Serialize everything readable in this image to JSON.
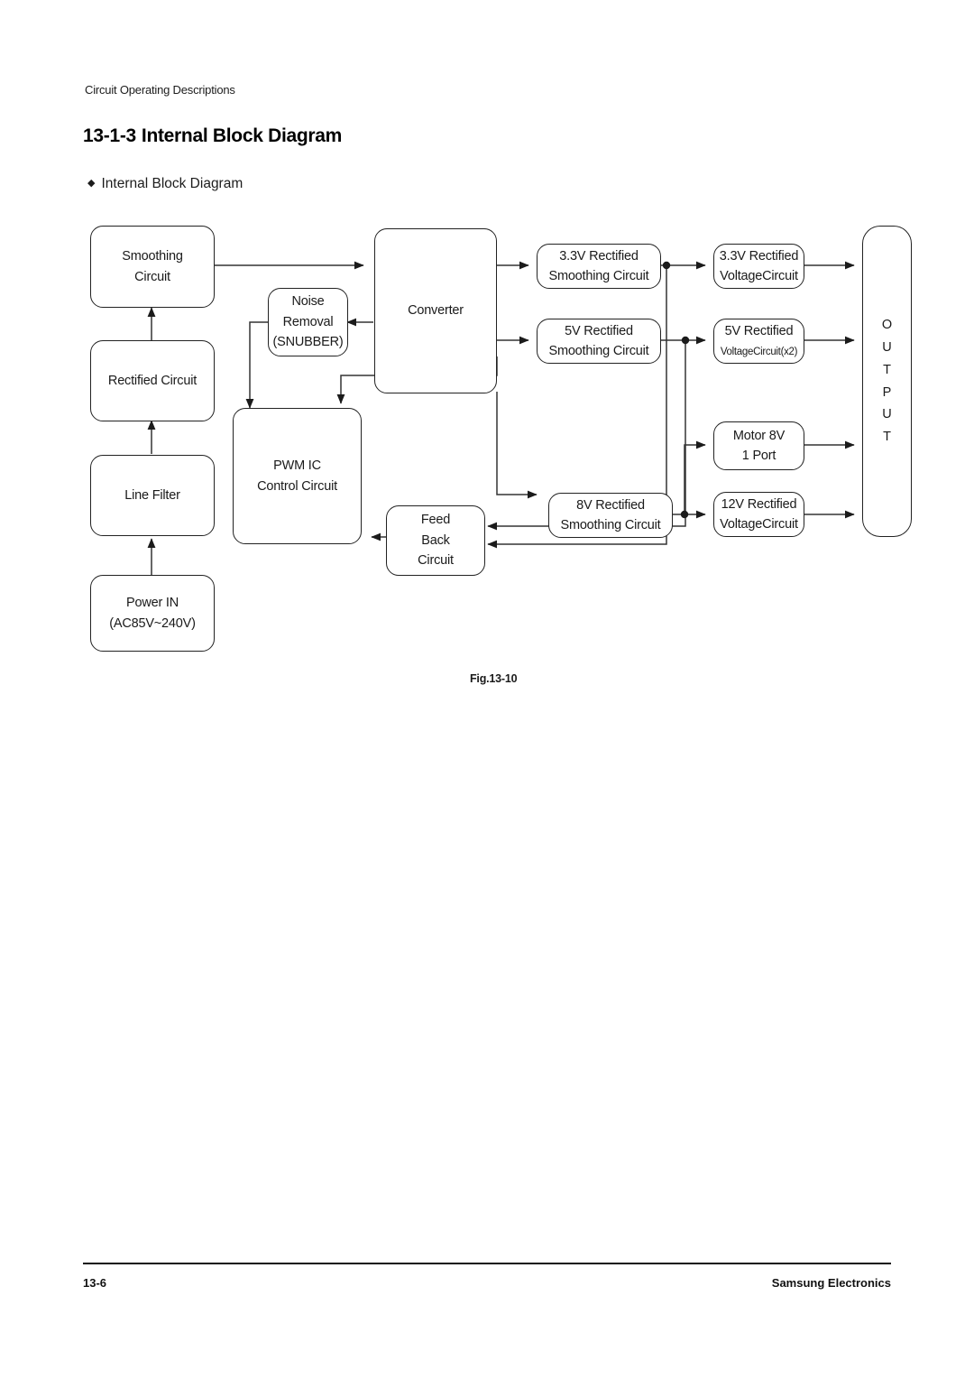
{
  "page": {
    "running_head": "Circuit Operating Descriptions",
    "title_number": "13-1-3",
    "title_text": "Internal Block Diagram",
    "bullet_glyph": "◆",
    "bullet_text": "Internal Block Diagram",
    "figure_caption": "Fig.13-10",
    "footer_page": "13-6",
    "footer_brand": "Samsung Electronics"
  },
  "diagram": {
    "title": "Internal Block Diagram",
    "nodes": {
      "smoothing_circuit": {
        "line1": "Smoothing",
        "line2": "Circuit"
      },
      "rectified_circuit": {
        "line1": "Rectified Circuit",
        "line2": ""
      },
      "line_filter": {
        "line1": "Line Filter",
        "line2": ""
      },
      "power_in": {
        "line1": "Power IN",
        "line2": "(AC85V~240V)"
      },
      "noise_removal": {
        "line1": "Noise",
        "line2": "Removal",
        "line3": "(SNUBBER)"
      },
      "pwm_ic": {
        "line1": "PWM IC",
        "line2": "Control Circuit"
      },
      "converter": {
        "line1": "Converter",
        "line2": ""
      },
      "feed_back": {
        "line1": "Feed",
        "line2": "Back",
        "line3": "Circuit"
      },
      "rect_smooth_33v": {
        "line1": "3.3V Rectified",
        "line2": "Smoothing Circuit"
      },
      "rect_smooth_5v": {
        "line1": "5V Rectified",
        "line2": "Smoothing Circuit"
      },
      "rect_smooth_8v": {
        "line1": "8V Rectified",
        "line2": "Smoothing Circuit"
      },
      "volt_33v": {
        "line1": "3.3V Rectified",
        "line2": "VoltageCircuit"
      },
      "volt_5v": {
        "line1": "5V Rectified",
        "line2": "VoltageCircuit",
        "line2_suffix": "(x2)"
      },
      "motor_8v": {
        "line1": "Motor 8V",
        "line2": "1 Port"
      },
      "volt_12v": {
        "line1": "12V Rectified",
        "line2": "VoltageCircuit"
      },
      "output": {
        "letters": "OUTPUT"
      }
    },
    "colors": {
      "stroke": "#222222",
      "text": "#1a1a1a",
      "background": "#ffffff"
    }
  }
}
